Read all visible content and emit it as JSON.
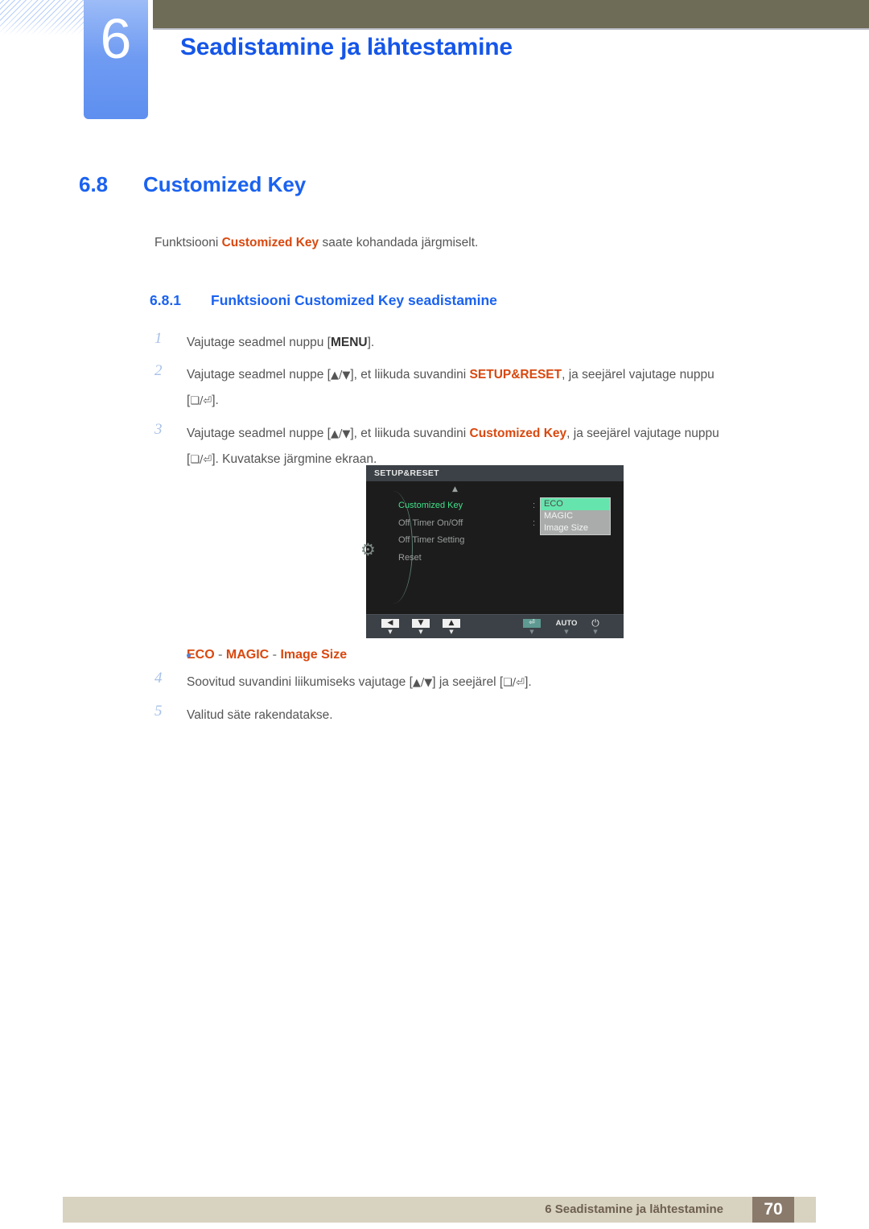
{
  "header": {
    "chapter_number": "6",
    "chapter_title": "Seadistamine ja lähtestamine"
  },
  "section": {
    "number": "6.8",
    "title": "Customized Key",
    "intro_before": "Funktsiooni ",
    "intro_keyword": "Customized Key",
    "intro_after": " saate kohandada järgmiselt."
  },
  "subsection": {
    "number": "6.8.1",
    "title": "Funktsiooni Customized Key seadistamine"
  },
  "steps": [
    {
      "num": "1",
      "parts": [
        {
          "t": "Vajutage seadmel nuppu [",
          "style": "normal"
        },
        {
          "t": "MENU",
          "style": "btn"
        },
        {
          "t": "].",
          "style": "normal"
        }
      ]
    },
    {
      "num": "2",
      "parts": [
        {
          "t": "Vajutage seadmel nuppe [",
          "style": "normal"
        },
        {
          "t": "▲/▼",
          "style": "glyph"
        },
        {
          "t": "], et liikuda suvandini ",
          "style": "normal"
        },
        {
          "t": "SETUP&RESET",
          "style": "kw"
        },
        {
          "t": ", ja seejärel vajutage nuppu",
          "style": "normal"
        },
        {
          "t": "\n",
          "style": "break"
        },
        {
          "t": "[",
          "style": "normal"
        },
        {
          "t": "❑/⏎",
          "style": "glyph"
        },
        {
          "t": "].",
          "style": "normal"
        }
      ]
    },
    {
      "num": "3",
      "parts": [
        {
          "t": "Vajutage seadmel nuppe [",
          "style": "normal"
        },
        {
          "t": "▲/▼",
          "style": "glyph"
        },
        {
          "t": "], et liikuda suvandini ",
          "style": "normal"
        },
        {
          "t": "Customized Key",
          "style": "kw"
        },
        {
          "t": ", ja seejärel vajutage nuppu",
          "style": "normal"
        },
        {
          "t": "\n",
          "style": "break"
        },
        {
          "t": "[",
          "style": "normal"
        },
        {
          "t": "❑/⏎",
          "style": "glyph"
        },
        {
          "t": "]. Kuvatakse järgmine ekraan.",
          "style": "normal"
        }
      ]
    }
  ],
  "osd": {
    "title": "SETUP&RESET",
    "caret_icon": "up-caret-icon",
    "gear_icon": "gear-icon",
    "menu_items": [
      {
        "label": "Customized Key",
        "selected": true
      },
      {
        "label": "Off Timer On/Off",
        "selected": false
      },
      {
        "label": "Off Timer Setting",
        "selected": false
      },
      {
        "label": "Reset",
        "selected": false
      }
    ],
    "colon_1": ":",
    "colon_2": ":",
    "submenu_items": [
      {
        "label": "ECO",
        "selected": true
      },
      {
        "label": "MAGIC",
        "selected": false
      },
      {
        "label": "Image Size",
        "selected": false
      }
    ],
    "keys": [
      {
        "name": "left-arrow-key",
        "glyph": "◀",
        "type": "box"
      },
      {
        "name": "down-arrow-key",
        "glyph": "▼",
        "type": "box"
      },
      {
        "name": "up-arrow-key",
        "glyph": "▲",
        "type": "box"
      },
      {
        "name": "enter-key",
        "glyph": "⏎",
        "type": "enter"
      },
      {
        "name": "auto-key",
        "glyph": "AUTO",
        "type": "text"
      },
      {
        "name": "power-key",
        "glyph": "⏻",
        "type": "power"
      }
    ]
  },
  "bullet": {
    "item_1": "ECO",
    "sep_1": " - ",
    "item_2": "MAGIC",
    "sep_2": " - ",
    "item_3": "Image Size"
  },
  "steps2": [
    {
      "num": "4",
      "parts": [
        {
          "t": "Soovitud suvandini liikumiseks vajutage [",
          "style": "normal"
        },
        {
          "t": "▲/▼",
          "style": "glyph"
        },
        {
          "t": "] ja seejärel [",
          "style": "normal"
        },
        {
          "t": "❑/⏎",
          "style": "glyph"
        },
        {
          "t": "].",
          "style": "normal"
        }
      ]
    },
    {
      "num": "5",
      "parts": [
        {
          "t": "Valitud säte rakendatakse.",
          "style": "normal"
        }
      ]
    }
  ],
  "footer": {
    "text": "6 Seadistamine ja lähtestamine",
    "page": "70"
  },
  "colors": {
    "heading_blue": "#1a62f0",
    "keyword_orange": "#d9480f",
    "olive": "#6e6b56",
    "footer_bg": "#d8d2c0",
    "footer_page_bg": "#8a7a6b",
    "osd_select_green": "#42e08a",
    "osd_submenu_green": "#65e5ad"
  }
}
